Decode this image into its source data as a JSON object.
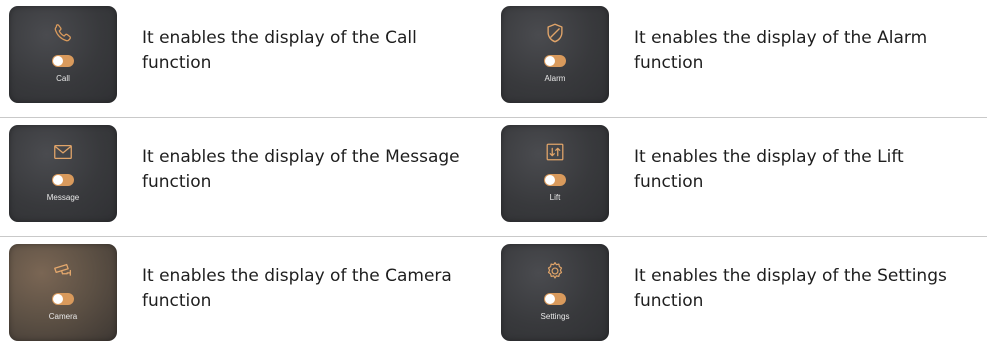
{
  "features": [
    {
      "icon": "phone-icon",
      "tile_label": "Call",
      "description": "It enables the display of the Call function"
    },
    {
      "icon": "shield-icon",
      "tile_label": "Alarm",
      "description": "It enables the display of the Alarm function"
    },
    {
      "icon": "envelope-icon",
      "tile_label": "Message",
      "description": "It enables the display of the Message function"
    },
    {
      "icon": "lift-icon",
      "tile_label": "Lift",
      "description": "It enables the display of the Lift function"
    },
    {
      "icon": "camera-icon",
      "tile_label": "Camera",
      "description": "It enables the display of the Camera function"
    },
    {
      "icon": "gear-icon",
      "tile_label": "Settings",
      "description": "It enables the display of the Settings function"
    }
  ],
  "colors": {
    "accent": "#d99a5c",
    "tile_bg": "#38393c",
    "divider": "#c9c9c9",
    "text": "#1e1e1e"
  }
}
